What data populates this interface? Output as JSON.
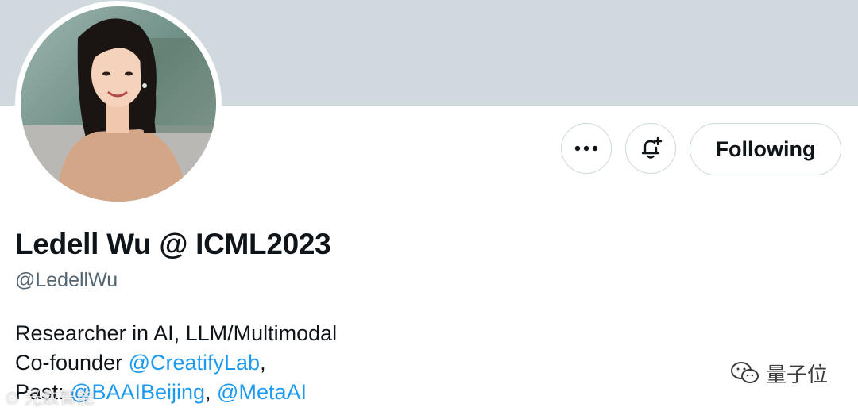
{
  "profile": {
    "display_name": "Ledell Wu @ ICML2023",
    "handle": "@LedellWu",
    "avatar_alt": "profile photo"
  },
  "actions": {
    "more_icon": "more-horizontal-icon",
    "notify_icon": "bell-plus-icon",
    "following_label": "Following"
  },
  "bio": {
    "line1": "Researcher in AI, LLM/Multimodal",
    "line2_prefix": "Co-founder ",
    "line2_link": "@CreatifyLab",
    "line2_suffix": ",",
    "line3_prefix": "Past: ",
    "line3_link1": "@BAAIBeijing",
    "line3_sep": ", ",
    "line3_link2": "@MetaAI"
  },
  "watermarks": {
    "right_text": "量子位",
    "left_text": "⊙ 光数智能"
  },
  "colors": {
    "banner": "#cfd9de",
    "link": "#1d9bf0",
    "secondary_text": "#536471",
    "border": "#cfd9de"
  }
}
